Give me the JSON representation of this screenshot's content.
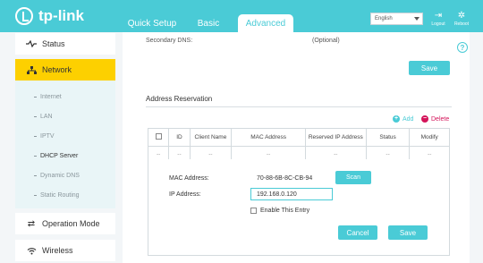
{
  "brand": {
    "name": "tp-link",
    "logo_icon": "tp-link-logo-icon"
  },
  "header": {
    "tabs": [
      {
        "label": "Quick Setup"
      },
      {
        "label": "Basic"
      },
      {
        "label": "Advanced",
        "active": true
      }
    ],
    "language": "English",
    "logout_label": "Logout",
    "reboot_label": "Reboot",
    "accent_color": "#4acbd6"
  },
  "sidebar": {
    "items": [
      {
        "label": "Status",
        "icon": "pulse-icon"
      },
      {
        "label": "Network",
        "icon": "network-icon",
        "active": true
      },
      {
        "label": "Operation Mode",
        "icon": "swap-icon"
      },
      {
        "label": "Wireless",
        "icon": "wifi-icon"
      }
    ],
    "subitems": [
      "Internet",
      "LAN",
      "IPTV",
      "DHCP Server",
      "Dynamic DNS",
      "Static Routing"
    ],
    "selected_subitem": "DHCP Server",
    "active_color": "#fdd000"
  },
  "main": {
    "secondary_dns_label": "Secondary DNS:",
    "optional_label": "(Optional)",
    "save_label": "Save",
    "section_title": "Address Reservation",
    "add_label": "Add",
    "delete_label": "Delete",
    "table": {
      "headers": [
        "ID",
        "Client Name",
        "MAC Address",
        "Reserved IP Address",
        "Status",
        "Modify"
      ],
      "row": [
        "--",
        "--",
        "--",
        "--",
        "--",
        "--",
        "--"
      ]
    },
    "form": {
      "mac_label": "MAC Address:",
      "mac_value": "70-88-6B-8C-CB-94",
      "scan_label": "Scan",
      "ip_label": "IP Address:",
      "ip_value": "192.168.0.120",
      "enable_label": "Enable This Entry",
      "cancel_label": "Cancel",
      "save_label": "Save"
    }
  }
}
